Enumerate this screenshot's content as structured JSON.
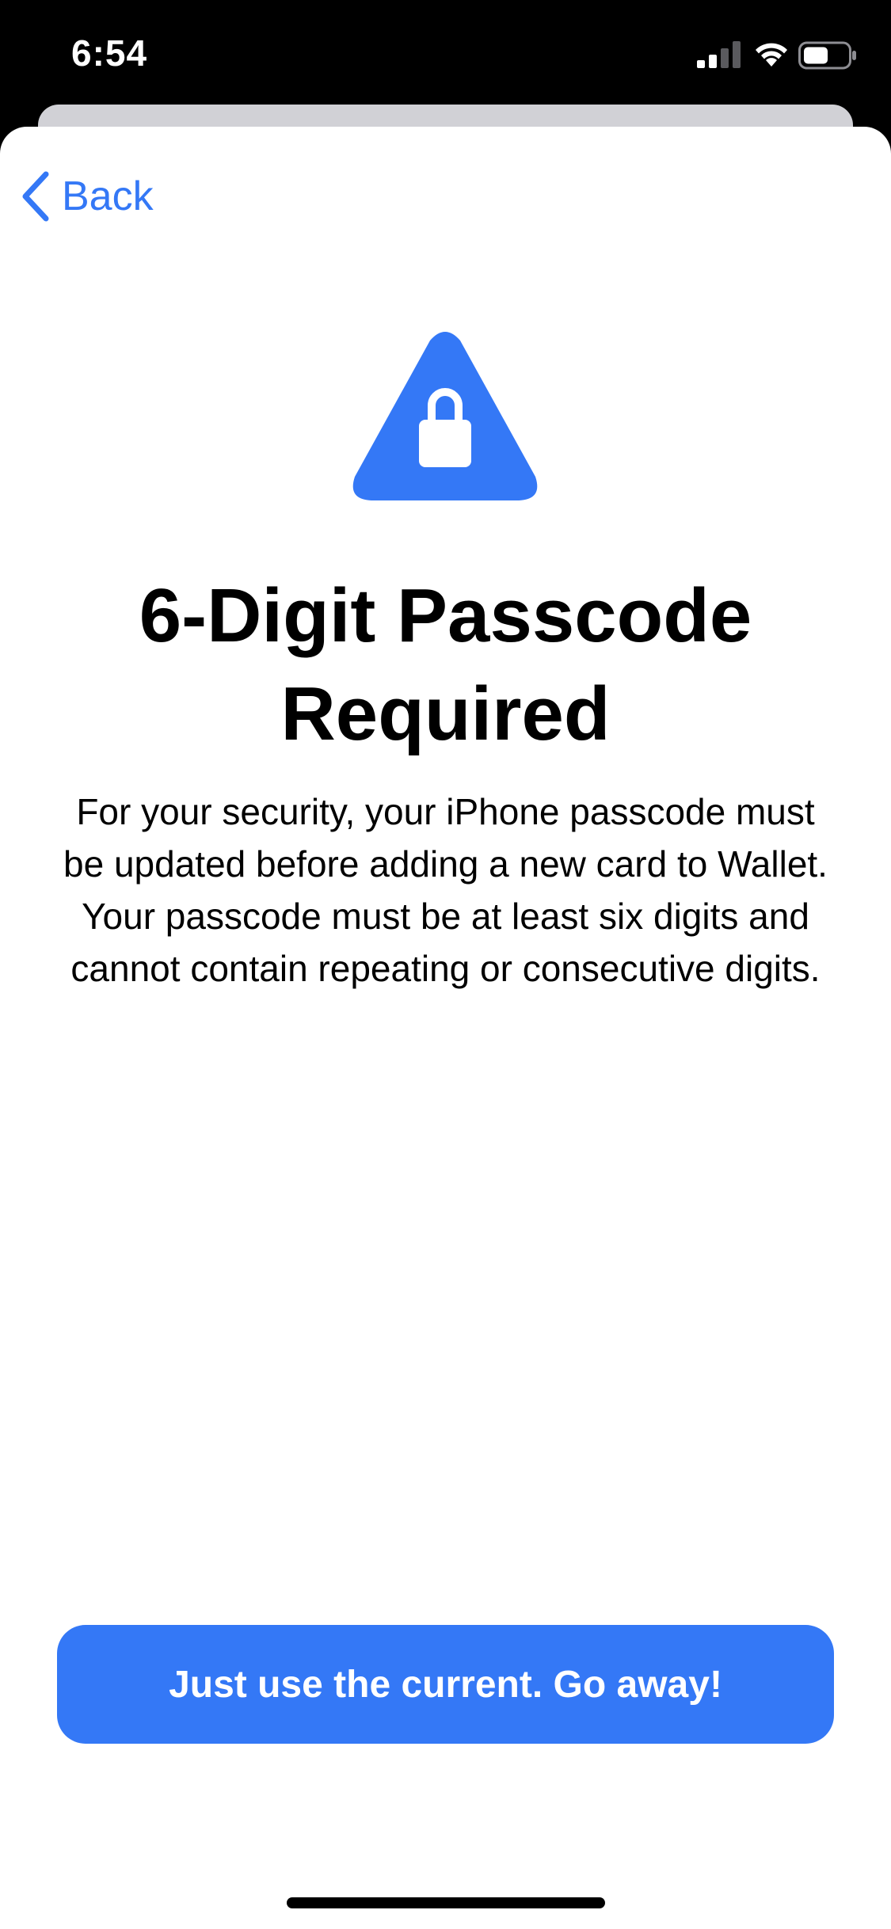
{
  "status_bar": {
    "time": "6:54",
    "icons": [
      "signal-icon",
      "wifi-icon",
      "battery-icon"
    ]
  },
  "nav": {
    "back_label": "Back",
    "back_icon": "chevron-left-icon"
  },
  "hero": {
    "icon": "lock-warning-icon",
    "title": "6-Digit Passcode Required",
    "description": "For your security, your iPhone passcode must be updated before adding a new card to Wallet. Your passcode must be at least six digits and cannot contain repeating or consecutive digits."
  },
  "actions": {
    "primary_label": "Just use the current. Go away!"
  },
  "colors": {
    "accent": "#3478f6",
    "background": "#ffffff",
    "status_bar": "#000000",
    "sheet_behind": "#d1d1d6"
  }
}
